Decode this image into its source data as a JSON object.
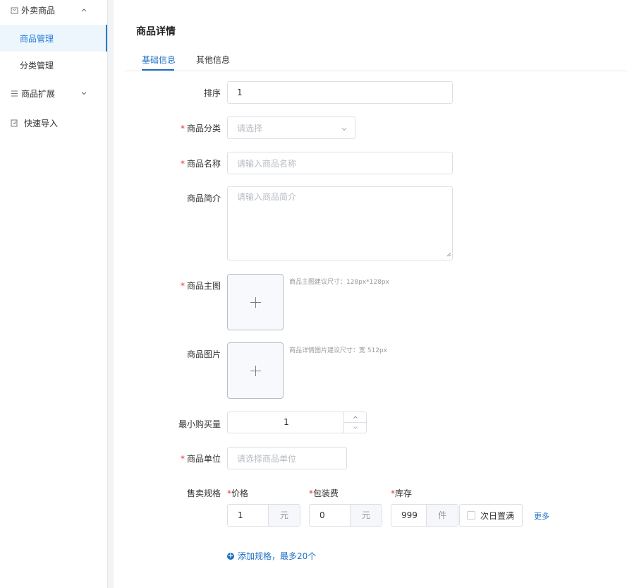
{
  "sidebar": {
    "groups": [
      {
        "label": "外卖商品",
        "icon": "bag-icon",
        "expanded": true
      },
      {
        "label": "商品扩展",
        "icon": "list-icon",
        "expanded": false
      },
      {
        "label": "快速导入",
        "icon": "import-icon"
      }
    ],
    "items": [
      {
        "label": "商品管理",
        "active": true
      },
      {
        "label": "分类管理",
        "active": false
      }
    ]
  },
  "main": {
    "title": "商品详情",
    "tabs": [
      {
        "label": "基础信息",
        "active": true
      },
      {
        "label": "其他信息",
        "active": false
      }
    ]
  },
  "form": {
    "sort": {
      "label": "排序",
      "value": "1"
    },
    "category": {
      "label": "商品分类",
      "placeholder": "请选择"
    },
    "name": {
      "label": "商品名称",
      "placeholder": "请输入商品名称"
    },
    "intro": {
      "label": "商品简介",
      "placeholder": "请输入商品简介"
    },
    "main_image": {
      "label": "商品主图",
      "hint": "商品主图建议尺寸：128px*128px"
    },
    "images": {
      "label": "商品图片",
      "hint": "商品详情图片建议尺寸：宽 512px"
    },
    "min_qty": {
      "label": "最小购买量",
      "value": "1"
    },
    "unit": {
      "label": "商品单位",
      "placeholder": "请选择商品单位"
    },
    "spec": {
      "label": "售卖规格",
      "price": {
        "label": "价格",
        "value": "1",
        "suffix": "元"
      },
      "package": {
        "label": "包装费",
        "value": "0",
        "suffix": "元"
      },
      "stock": {
        "label": "库存",
        "value": "999",
        "suffix": "件"
      },
      "next_day_full": "次日置满",
      "more": "更多",
      "add": "添加规格，最多20个"
    },
    "required_mark": "*"
  },
  "colors": {
    "accent": "#1e6fc4",
    "required": "#e4393c"
  }
}
